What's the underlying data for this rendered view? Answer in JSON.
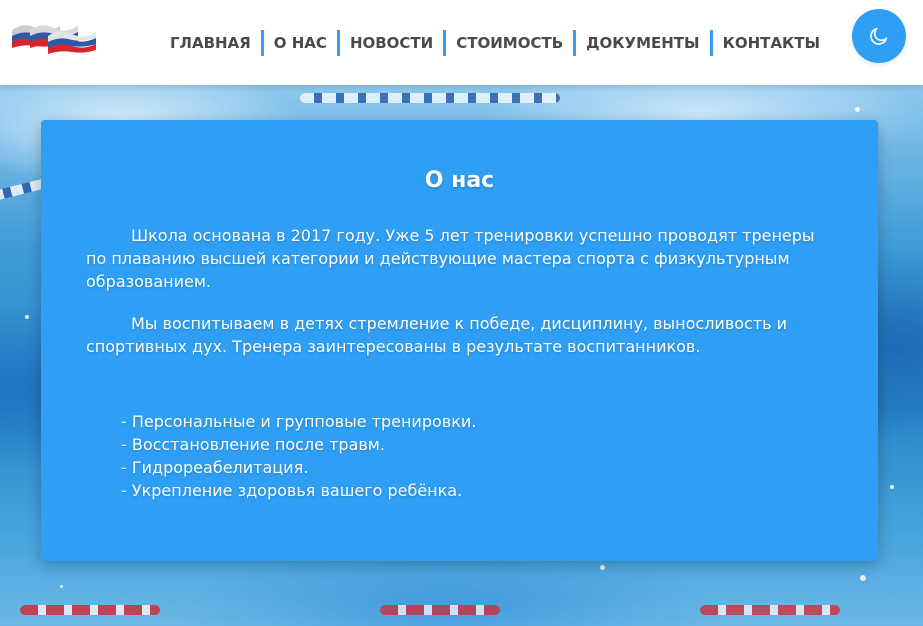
{
  "header": {
    "nav": [
      {
        "label": "ГЛАВНАЯ"
      },
      {
        "label": "О НАС"
      },
      {
        "label": "НОВОСТИ"
      },
      {
        "label": "СТОИМОСТЬ"
      },
      {
        "label": "ДОКУМЕНТЫ"
      },
      {
        "label": "КОНТАКТЫ"
      }
    ],
    "theme_toggle_icon": "moon-icon"
  },
  "about": {
    "title": "О нас",
    "paragraph_1": "Школа основана в 2017 году. Уже 5 лет тренировки успешно проводят тренеры по плаванию высшей категории и действующие мастера спорта с физкультурным образованием.",
    "paragraph_2": "Мы воспитываем в детях стремление к победе, дисциплину, выносливость и спортивных дух. Тренера заинтересованы в результате воспитанников.",
    "list": [
      "Персональные и групповые тренировки.",
      "Восстановление после травм.",
      "Гидрореабелитация.",
      "Укрепление здоровья вашего ребёнка."
    ]
  },
  "colors": {
    "accent": "#2e9ff4",
    "nav_text": "#4a4a4a",
    "separator": "#3c9de6",
    "flag_white": "#ffffff",
    "flag_blue": "#2a5aa8",
    "flag_red": "#d8262e"
  }
}
